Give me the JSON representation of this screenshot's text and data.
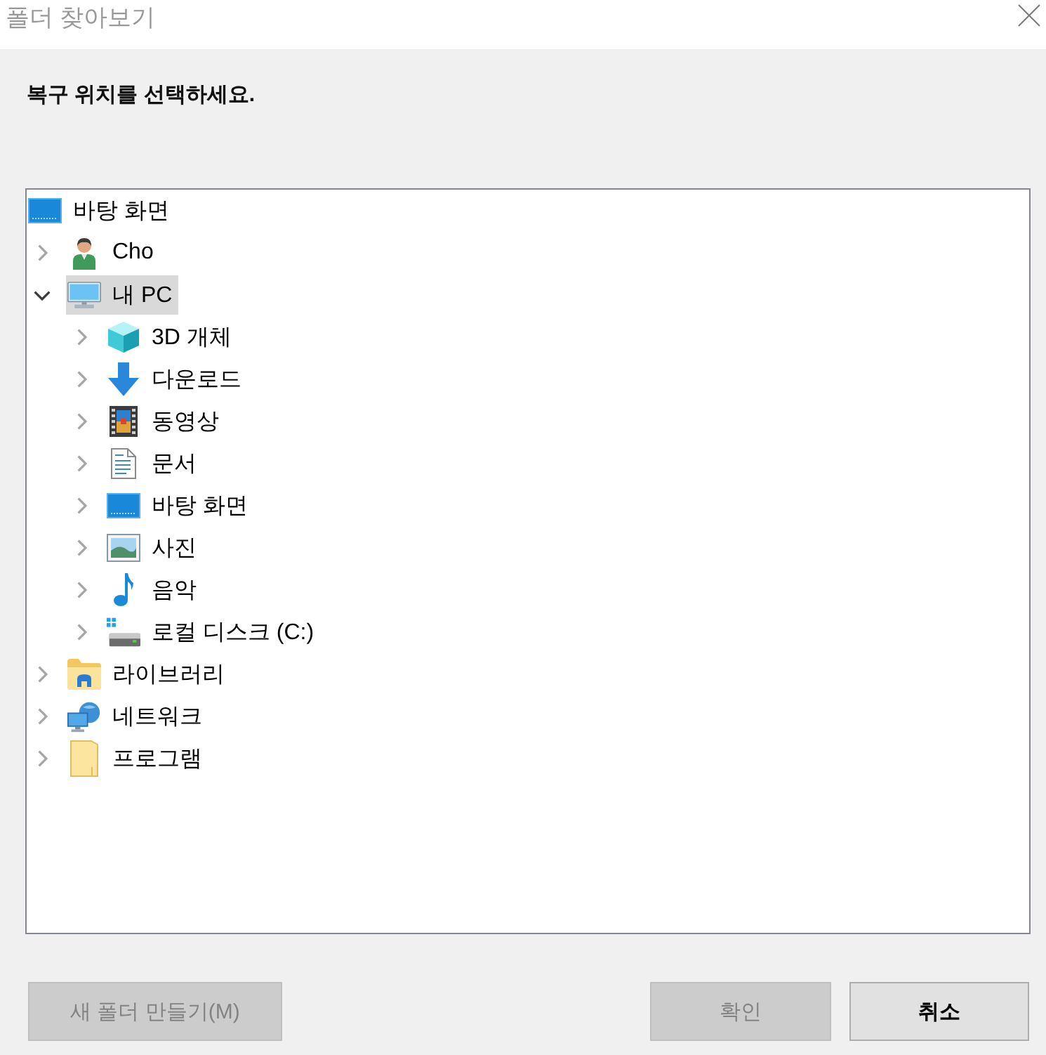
{
  "window": {
    "title": "폴더 찾아보기"
  },
  "instruction": "복구 위치를 선택하세요.",
  "tree": {
    "items": [
      {
        "label": "바탕 화면",
        "kind": "desktop",
        "selected": false,
        "children": [
          {
            "label": "Cho",
            "kind": "user",
            "selected": false,
            "expanded": false
          },
          {
            "label": "내 PC",
            "kind": "computer",
            "selected": true,
            "expanded": true,
            "children": [
              {
                "label": "3D 개체",
                "kind": "objects3d",
                "selected": false,
                "expanded": false
              },
              {
                "label": "다운로드",
                "kind": "downloads",
                "selected": false,
                "expanded": false
              },
              {
                "label": "동영상",
                "kind": "videos",
                "selected": false,
                "expanded": false
              },
              {
                "label": "문서",
                "kind": "documents",
                "selected": false,
                "expanded": false
              },
              {
                "label": "바탕 화면",
                "kind": "desktop",
                "selected": false,
                "expanded": false
              },
              {
                "label": "사진",
                "kind": "pictures",
                "selected": false,
                "expanded": false
              },
              {
                "label": "음악",
                "kind": "music",
                "selected": false,
                "expanded": false
              },
              {
                "label": "로컬 디스크 (C:)",
                "kind": "drive",
                "selected": false,
                "expanded": false
              }
            ]
          },
          {
            "label": "라이브러리",
            "kind": "libraries",
            "selected": false,
            "expanded": false
          },
          {
            "label": "네트워크",
            "kind": "network",
            "selected": false,
            "expanded": false
          },
          {
            "label": "프로그램",
            "kind": "folder",
            "selected": false,
            "expanded": false
          }
        ]
      }
    ]
  },
  "new_folder_button": {
    "label": "새 폴더 만들기(M)",
    "disabled": true
  },
  "buttons": [
    {
      "label": "확인",
      "disabled": true
    },
    {
      "label": "취소",
      "disabled": false
    }
  ]
}
